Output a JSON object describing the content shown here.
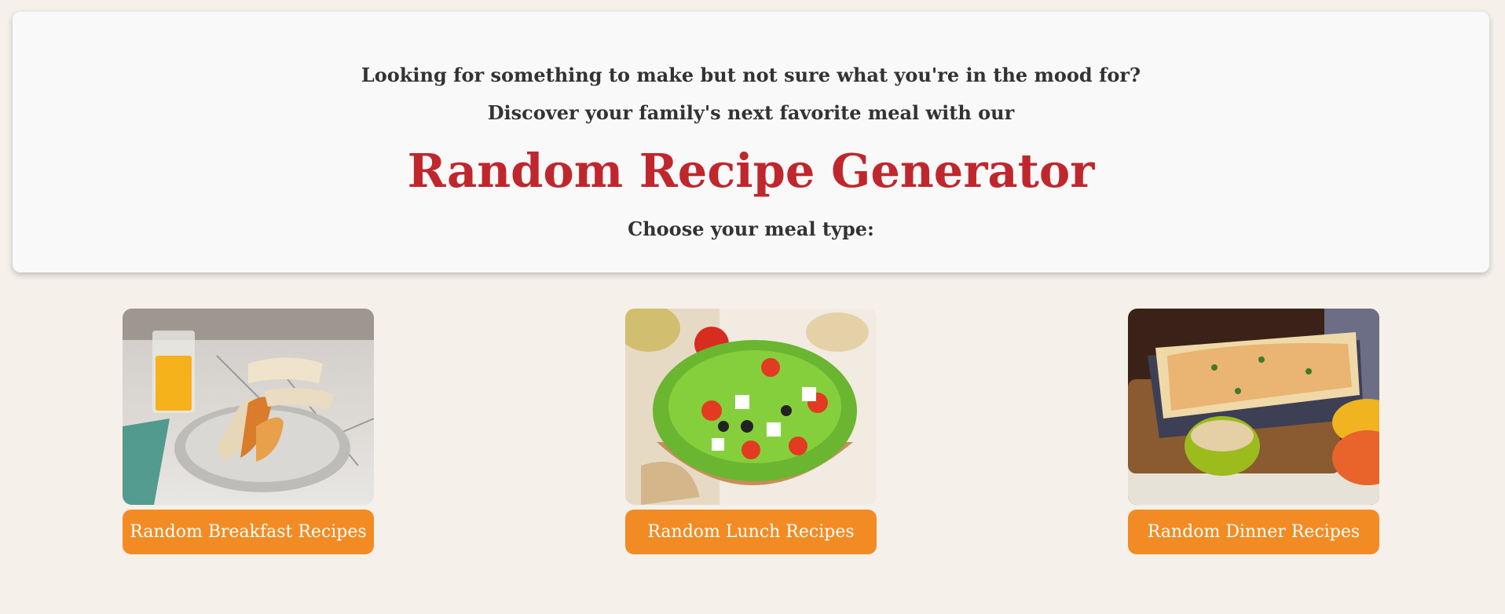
{
  "hero": {
    "line1": "Looking for something to make but not sure what you're in the mood for?",
    "line2": "Discover your family's next favorite meal with our",
    "title": "Random Recipe Generator",
    "choose": "Choose your meal type:"
  },
  "cards": [
    {
      "image_alt": "breakfast burritos on a plate with orange juice",
      "button": "Random Breakfast Recipes"
    },
    {
      "image_alt": "green salad with tomatoes, feta and olives in a wooden bowl",
      "button": "Random Lunch Recipes"
    },
    {
      "image_alt": "baked pasta casserole with bowls",
      "button": "Random Dinner Recipes"
    }
  ],
  "colors": {
    "background": "#f5f0ea",
    "title_red": "#c0272d",
    "button_orange": "#f38b24",
    "panel": "#f9f9f9"
  }
}
